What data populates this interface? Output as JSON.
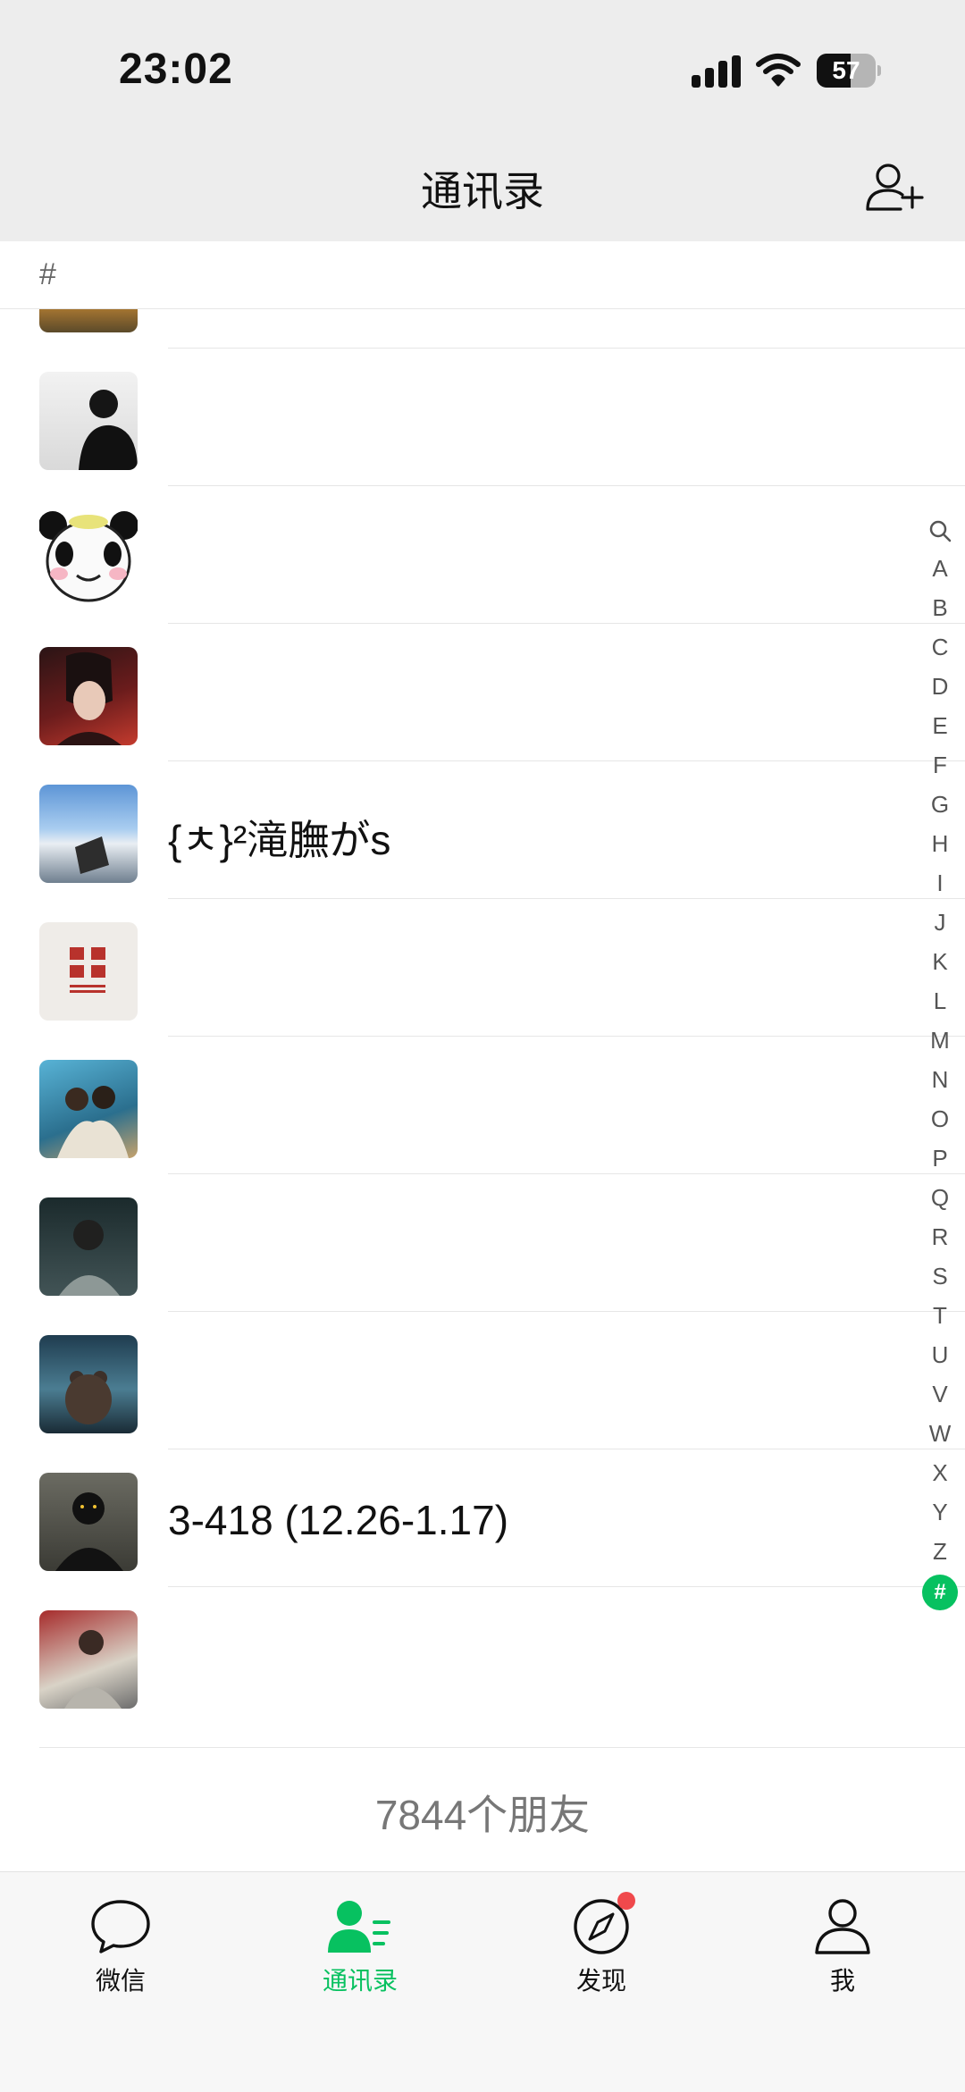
{
  "status_bar": {
    "time": "23:02",
    "battery": "57",
    "battery_level": 0.57
  },
  "nav": {
    "title": "通讯录"
  },
  "section": {
    "letter": "#"
  },
  "contacts": [
    {
      "name": "",
      "avatar": "sunset"
    },
    {
      "name": "",
      "avatar": "profile-bw"
    },
    {
      "name": "",
      "avatar": "panda"
    },
    {
      "name": "",
      "avatar": "anime"
    },
    {
      "name": "{ㅊ}²滝膴がs",
      "avatar": "sky"
    },
    {
      "name": "",
      "avatar": "calligraphy"
    },
    {
      "name": "",
      "avatar": "couple"
    },
    {
      "name": "",
      "avatar": "car"
    },
    {
      "name": "",
      "avatar": "bear"
    },
    {
      "name": "3-418 (12.26-1.17)",
      "avatar": "dark"
    },
    {
      "name": "",
      "avatar": "street"
    }
  ],
  "index": [
    "A",
    "B",
    "C",
    "D",
    "E",
    "F",
    "G",
    "H",
    "I",
    "J",
    "K",
    "L",
    "M",
    "N",
    "O",
    "P",
    "Q",
    "R",
    "S",
    "T",
    "U",
    "V",
    "W",
    "X",
    "Y",
    "Z",
    "#"
  ],
  "footer": {
    "count": "7844个朋友"
  },
  "tabs": [
    {
      "label": "微信"
    },
    {
      "label": "通讯录"
    },
    {
      "label": "发现"
    },
    {
      "label": "我"
    }
  ],
  "colors": {
    "accent": "#07c160",
    "badge": "#f0494c"
  }
}
